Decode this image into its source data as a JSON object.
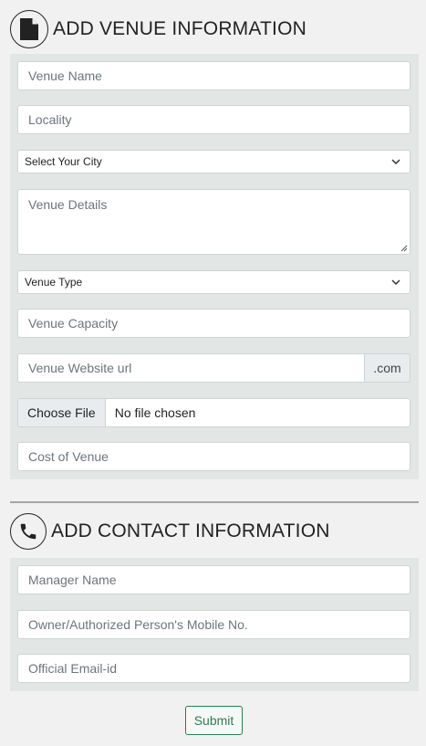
{
  "venue_section": {
    "title": "ADD VENUE INFORMATION",
    "icon": "document-icon",
    "fields": {
      "venue_name_placeholder": "Venue Name",
      "locality_placeholder": "Locality",
      "city_select": "Select Your City",
      "venue_details_placeholder": "Venue Details",
      "venue_type_select": "Venue Type",
      "venue_capacity_placeholder": "Venue Capacity",
      "website_placeholder": "Venue Website url",
      "website_suffix": ".com",
      "file_button": "Choose File",
      "file_status": "No file chosen",
      "cost_placeholder": "Cost of Venue"
    }
  },
  "contact_section": {
    "title": "ADD CONTACT INFORMATION",
    "icon": "phone-icon",
    "fields": {
      "manager_placeholder": "Manager Name",
      "mobile_placeholder": "Owner/Authorized Person's Mobile No.",
      "email_placeholder": "Official Email-id"
    }
  },
  "submit_label": "Submit",
  "colors": {
    "page_bg": "#f1f1f1",
    "panel_bg": "#e2e6e4",
    "submit_accent": "#2e7d52"
  }
}
